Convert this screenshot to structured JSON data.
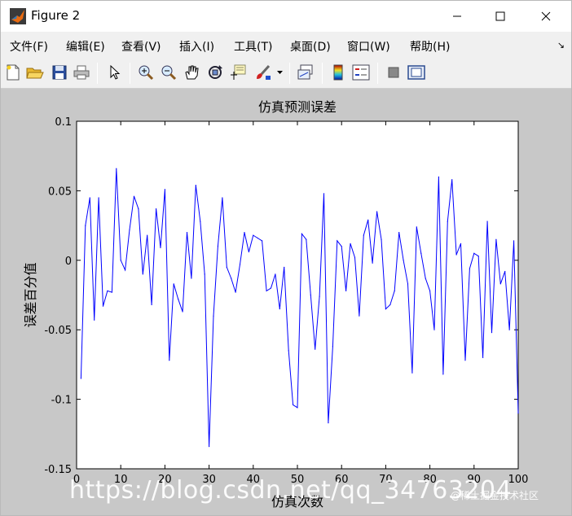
{
  "window": {
    "title": "Figure 2"
  },
  "menu": [
    {
      "label": "文件(F)"
    },
    {
      "label": "编辑(E)"
    },
    {
      "label": "查看(V)"
    },
    {
      "label": "插入(I)"
    },
    {
      "label": "工具(T)"
    },
    {
      "label": "桌面(D)"
    },
    {
      "label": "窗口(W)"
    },
    {
      "label": "帮助(H)"
    }
  ],
  "menu_dock_glyph": "↘",
  "toolbar_icons": [
    "new-figure-icon",
    "open-file-icon",
    "save-icon",
    "print-icon",
    "select-arrow-icon",
    "zoom-in-icon",
    "zoom-out-icon",
    "pan-hand-icon",
    "rotate-3d-icon",
    "data-cursor-icon",
    "brush-icon",
    "brush-dropdown-icon",
    "link-plot-icon",
    "colorbar-icon",
    "legend-icon",
    "hide-plot-tools-icon",
    "show-plot-tools-icon"
  ],
  "colors": {
    "line": "#0000ff",
    "figure_bg": "#c8c8c8",
    "axes_bg": "#ffffff"
  },
  "watermark": {
    "url": "https://blog.csdn.net/qq_34763204",
    "credit": "@稀土掘金技术社区"
  },
  "chart_data": {
    "type": "line",
    "title": "仿真预测误差",
    "xlabel": "仿真次数",
    "ylabel": "误差百分值",
    "xlim": [
      0,
      100
    ],
    "ylim": [
      -0.15,
      0.1
    ],
    "xticks": [
      0,
      10,
      20,
      30,
      40,
      50,
      60,
      70,
      80,
      90,
      100
    ],
    "yticks": [
      -0.15,
      -0.1,
      -0.05,
      0,
      0.05,
      0.1
    ],
    "ytick_labels": [
      "-0.15",
      "-0.1",
      "-0.05",
      "0",
      "0.05",
      "0.1"
    ],
    "grid": false,
    "series": [
      {
        "color": "#0000ff",
        "x": [
          1,
          2,
          3,
          4,
          5,
          6,
          7,
          8,
          9,
          10,
          11,
          12,
          13,
          14,
          15,
          16,
          17,
          18,
          19,
          20,
          21,
          22,
          23,
          24,
          25,
          26,
          27,
          28,
          29,
          30,
          31,
          32,
          33,
          34,
          35,
          36,
          37,
          38,
          39,
          40,
          41,
          42,
          43,
          44,
          45,
          46,
          47,
          48,
          49,
          50,
          51,
          52,
          53,
          54,
          55,
          56,
          57,
          58,
          59,
          60,
          61,
          62,
          63,
          64,
          65,
          66,
          67,
          68,
          69,
          70,
          71,
          72,
          73,
          74,
          75,
          76,
          77,
          78,
          79,
          80,
          81,
          82,
          83,
          84,
          85,
          86,
          87,
          88,
          89,
          90,
          91,
          92,
          93,
          94,
          95,
          96,
          97,
          98,
          99,
          100
        ],
        "values": [
          -0.085,
          0.025,
          0.045,
          -0.043,
          0.045,
          -0.033,
          -0.022,
          -0.023,
          0.066,
          0.0,
          -0.007,
          0.022,
          0.046,
          0.037,
          -0.01,
          0.018,
          -0.032,
          0.037,
          0.009,
          0.051,
          -0.072,
          -0.017,
          -0.028,
          -0.037,
          0.02,
          -0.013,
          0.054,
          0.028,
          -0.01,
          -0.134,
          -0.04,
          0.01,
          0.045,
          -0.005,
          -0.013,
          -0.023,
          -0.003,
          0.02,
          0.006,
          0.018,
          0.016,
          0.014,
          -0.022,
          -0.02,
          -0.01,
          -0.035,
          -0.005,
          -0.065,
          -0.104,
          -0.106,
          0.019,
          0.015,
          -0.025,
          -0.064,
          -0.026,
          0.048,
          -0.117,
          -0.062,
          0.014,
          0.01,
          -0.022,
          0.012,
          0.002,
          -0.04,
          0.018,
          0.029,
          -0.002,
          0.035,
          0.015,
          -0.035,
          -0.032,
          -0.022,
          0.02,
          0.0,
          -0.017,
          -0.081,
          0.024,
          0.005,
          -0.013,
          -0.022,
          -0.05,
          0.06,
          -0.082,
          0.028,
          0.058,
          0.004,
          0.012,
          -0.072,
          -0.006,
          0.005,
          0.003,
          -0.07,
          0.028,
          -0.052,
          0.015,
          -0.017,
          -0.008,
          -0.05,
          0.014,
          -0.11
        ]
      }
    ]
  }
}
